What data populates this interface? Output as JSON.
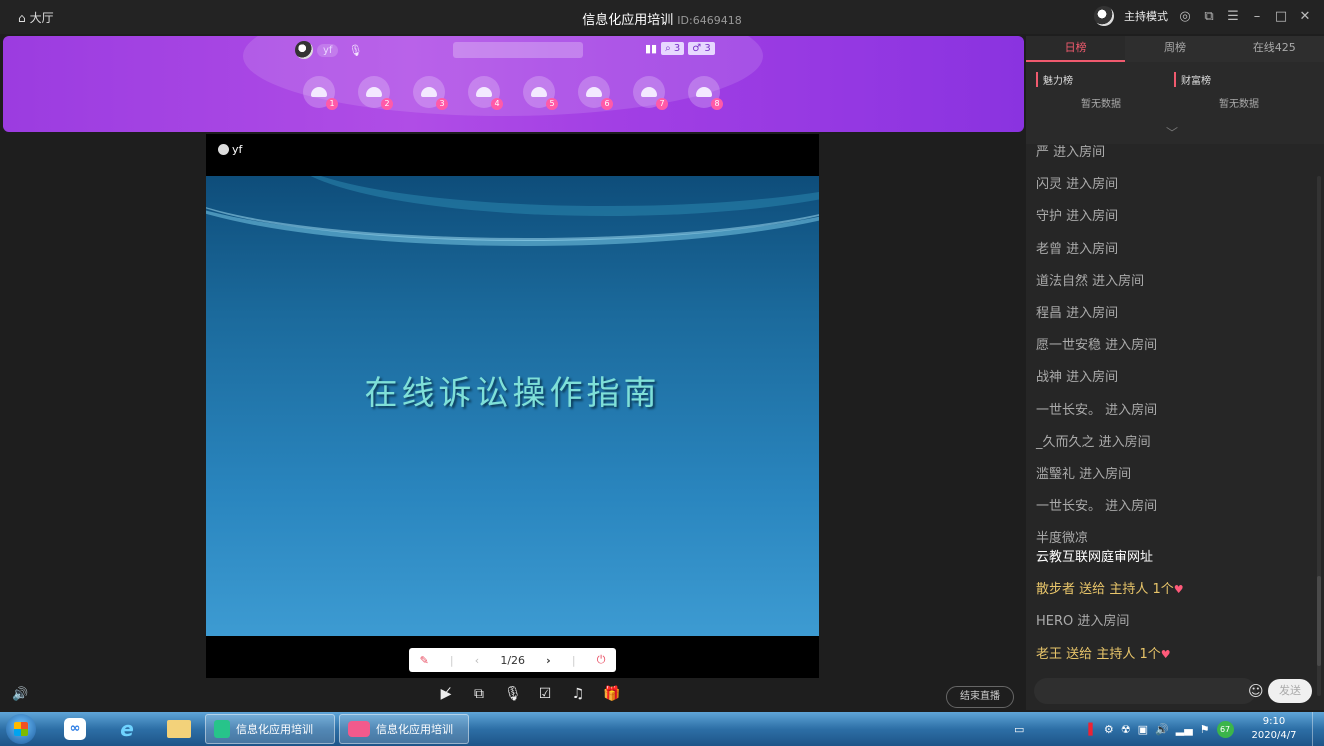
{
  "titlebar": {
    "hall_icon": "home-icon",
    "hall_label": "大厅",
    "title": "信息化应用培训",
    "room_id": "ID:6469418",
    "host_mode": "主持模式",
    "settings_icon": "gear-icon",
    "popout_icon": "popout-icon",
    "menu_icon": "menu-icon",
    "minimize": "–",
    "maximize": "□",
    "close": "✕"
  },
  "banner": {
    "anchor_name": "yf",
    "stats_icon": "bar-chart-icon",
    "search_count": "3",
    "male_count": "3",
    "seats": [
      "1",
      "2",
      "3",
      "4",
      "5",
      "6",
      "7",
      "8"
    ]
  },
  "stage": {
    "user": "yf",
    "slide_title": "在线诉讼操作指南",
    "page": "1/26"
  },
  "controls": {
    "end_live": "结束直播",
    "icons": [
      "camera-off-icon",
      "screen-share-icon",
      "microphone-icon",
      "edit-icon",
      "music-icon",
      "gift-icon"
    ]
  },
  "ranking": {
    "tabs": [
      "日榜",
      "周榜",
      "在线425"
    ],
    "charm": "魅力榜",
    "wealth": "财富榜",
    "empty": "暂无数据"
  },
  "chat": {
    "messages": [
      {
        "name": "严",
        "action": "进入房间"
      },
      {
        "name": "闪灵",
        "action": "进入房间"
      },
      {
        "name": "守护",
        "action": "进入房间"
      },
      {
        "name": "老曾",
        "action": "进入房间"
      },
      {
        "name": "道法自然",
        "action": "进入房间"
      },
      {
        "name": "程昌",
        "action": "进入房间"
      },
      {
        "name": "愿一世安稳",
        "action": "进入房间"
      },
      {
        "name": "战神",
        "action": "进入房间"
      },
      {
        "name": "一世长安。",
        "action": "进入房间"
      },
      {
        "name": "_久而久之",
        "action": "进入房间"
      },
      {
        "name": "滥瑿礼",
        "action": "进入房间"
      },
      {
        "name": "一世长安。",
        "action": "进入房间"
      }
    ],
    "text_msg_name": "半度微凉",
    "text_msg_body": "云教互联网庭审网址",
    "gift1": {
      "name": "散步者",
      "verb": "送给",
      "target": "主持人",
      "count": "1个"
    },
    "hero": {
      "name": "HERO",
      "action": "进入房间"
    },
    "gift2": {
      "name": "老王",
      "verb": "送给",
      "target": "主持人",
      "count": "1个"
    },
    "input_placeholder": "",
    "send": "发送"
  },
  "taskbar": {
    "task1": "信息化应用培训",
    "task2": "信息化应用培训",
    "badge": "67",
    "time": "9:10",
    "date": "2020/4/7"
  }
}
